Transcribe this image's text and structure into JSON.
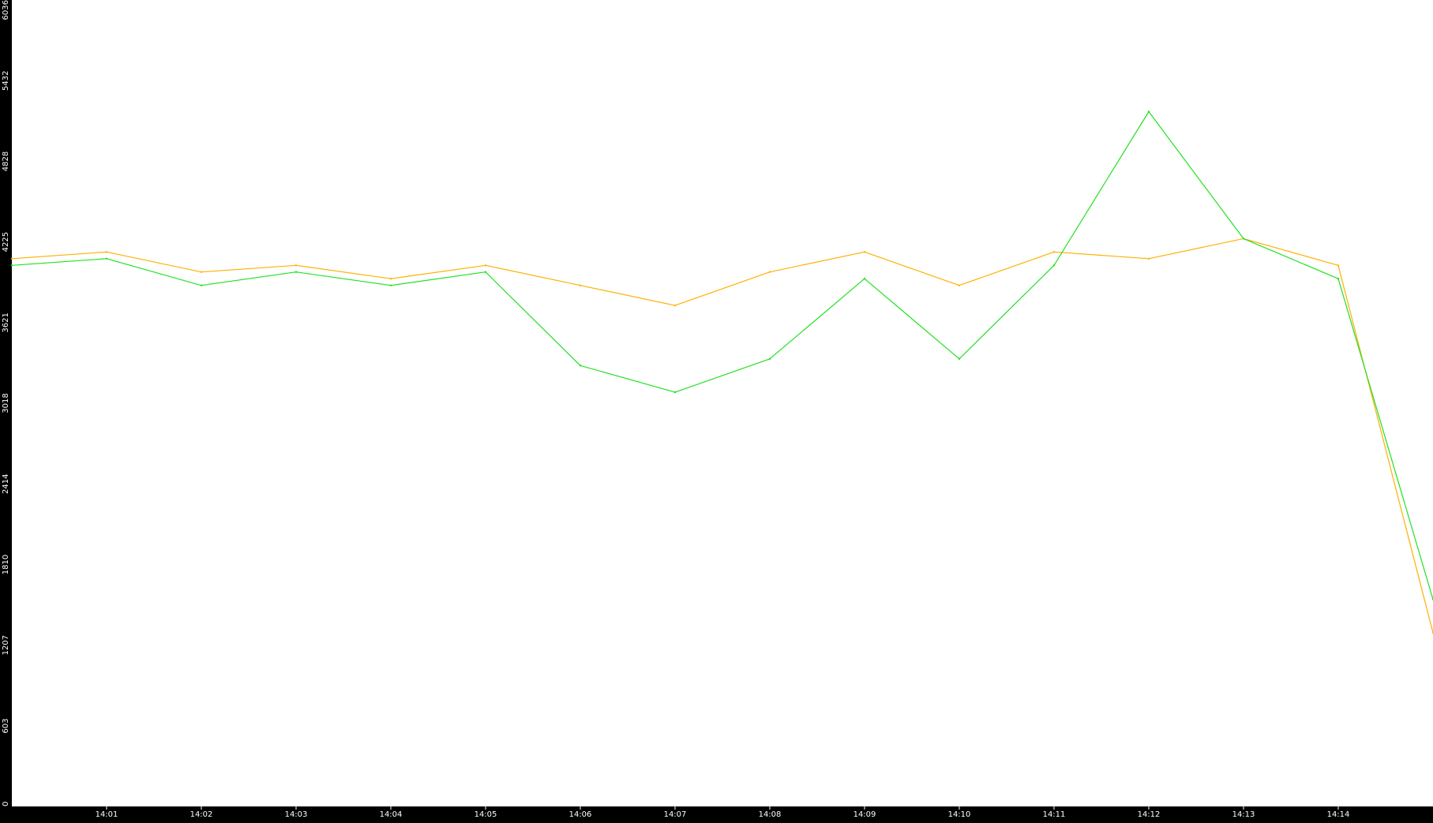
{
  "chart_data": {
    "type": "line",
    "title": "",
    "xlabel": "",
    "ylabel": "",
    "ylim": [
      0,
      6036
    ],
    "y_ticks": [
      0,
      603,
      1207,
      1810,
      2414,
      3018,
      3621,
      4225,
      4828,
      5432,
      6036
    ],
    "x_ticks": [
      "14:01",
      "14:02",
      "14:03",
      "14:04",
      "14:05",
      "14:06",
      "14:07",
      "14:08",
      "14:09",
      "14:10",
      "14:11",
      "14:12",
      "14:13",
      "14:14"
    ],
    "x_range": [
      "14:00:00",
      "14:15:00"
    ],
    "grid": false,
    "legend": "none",
    "background": "#ffffff",
    "frame_color": "#000000",
    "sample_interval_seconds": 60,
    "series": [
      {
        "color": "#ffb000",
        "x": [
          "14:00",
          "14:01",
          "14:02",
          "14:03",
          "14:04",
          "14:05",
          "14:06",
          "14:07",
          "14:08",
          "14:09",
          "14:10",
          "14:11",
          "14:12",
          "14:13",
          "14:14",
          "14:15"
        ],
        "values": [
          4100,
          4150,
          4000,
          4050,
          3950,
          4050,
          3900,
          3750,
          4000,
          4150,
          3900,
          4150,
          4100,
          4250,
          4050,
          1300
        ]
      },
      {
        "color": "#22e022",
        "x": [
          "14:00",
          "14:01",
          "14:02",
          "14:03",
          "14:04",
          "14:05",
          "14:06",
          "14:07",
          "14:08",
          "14:09",
          "14:10",
          "14:11",
          "14:12",
          "14:13",
          "14:14",
          "14:15"
        ],
        "values": [
          4050,
          4100,
          3900,
          4000,
          3900,
          4000,
          3300,
          3100,
          3350,
          3950,
          3350,
          4050,
          5200,
          4250,
          3950,
          1550
        ]
      }
    ]
  }
}
